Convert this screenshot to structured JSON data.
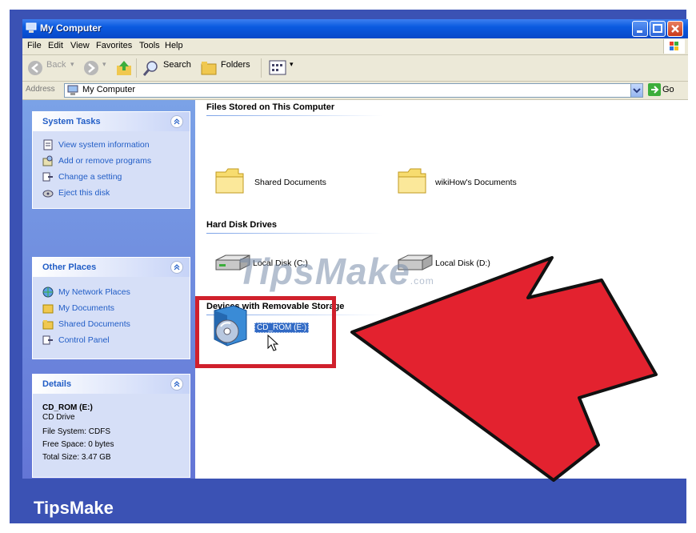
{
  "window": {
    "title": "My Computer"
  },
  "menu": [
    "File",
    "Edit",
    "View",
    "Favorites",
    "Tools",
    "Help"
  ],
  "toolbar": {
    "back_label": "Back",
    "search_label": "Search",
    "folders_label": "Folders"
  },
  "address": {
    "label": "Address",
    "value": "My Computer",
    "go_label": "Go"
  },
  "left": {
    "system_tasks": {
      "title": "System Tasks",
      "items": [
        "View system information",
        "Add or remove programs",
        "Change a setting",
        "Eject this disk"
      ]
    },
    "other_places": {
      "title": "Other Places",
      "items": [
        "My Network Places",
        "My Documents",
        "Shared Documents",
        "Control Panel"
      ]
    },
    "details": {
      "title": "Details",
      "name": "CD_ROM (E:)",
      "type": "CD Drive",
      "file_system": "File System: CDFS",
      "free_space": "Free Space: 0 bytes",
      "total_size": "Total Size: 3.47 GB"
    }
  },
  "content": {
    "files_group": "Files Stored on This Computer",
    "files": [
      "Shared Documents",
      "wikiHow's Documents"
    ],
    "drives_group": "Hard Disk Drives",
    "drives": [
      "Local Disk (C:)",
      "Local Disk (D:)"
    ],
    "removable_group": "Devices with Removable Storage",
    "removable": [
      "CD_ROM (E:)"
    ]
  },
  "watermark": {
    "main": "TipsMake",
    "suffix": ".com"
  },
  "brand": "TipsMake",
  "colors": {
    "background_blue": "#3b52b4",
    "arrow_red": "#e3222f",
    "titlebar": "#0a5ae0",
    "task_link": "#215dc6"
  }
}
